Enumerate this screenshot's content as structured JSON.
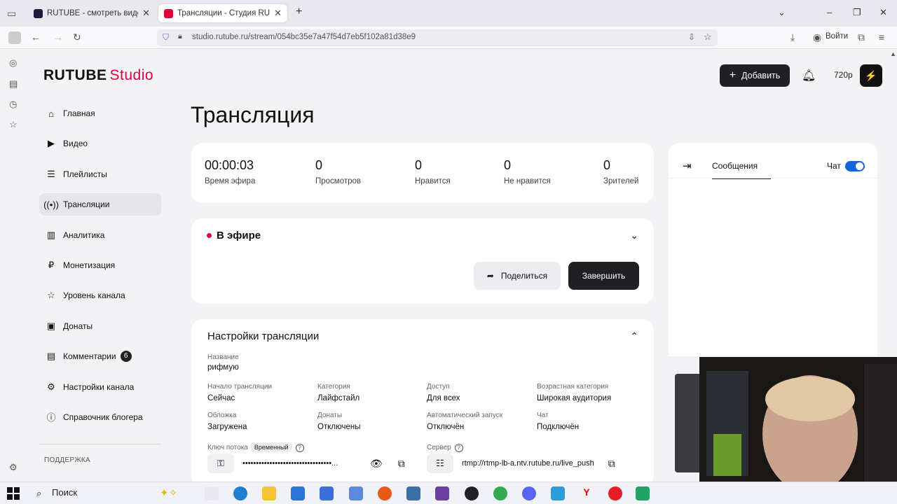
{
  "browser": {
    "tabs": [
      {
        "title": "RUTUBE - смотреть видео онл",
        "active": false
      },
      {
        "title": "Трансляции - Студия RUTUBE",
        "active": true
      }
    ],
    "url": "studio.rutube.ru/stream/054bc35e7a47f54d7eb5f102a81d38e9",
    "login_label": "Войти"
  },
  "app": {
    "logo_main": "RUTUBE",
    "logo_sub": "Studio",
    "add_label": "Добавить",
    "quality": "720p",
    "accent": "#e0003c"
  },
  "sidebar": {
    "items": [
      {
        "label": "Главная",
        "icon": "home-icon"
      },
      {
        "label": "Видео",
        "icon": "video-icon"
      },
      {
        "label": "Плейлисты",
        "icon": "playlist-icon"
      },
      {
        "label": "Трансляции",
        "icon": "broadcast-icon",
        "active": true
      },
      {
        "label": "Аналитика",
        "icon": "analytics-icon"
      },
      {
        "label": "Монетизация",
        "icon": "ruble-icon"
      },
      {
        "label": "Уровень канала",
        "icon": "star-icon"
      },
      {
        "label": "Донаты",
        "icon": "wallet-icon"
      },
      {
        "label": "Комментарии",
        "icon": "comment-icon",
        "badge": "6"
      },
      {
        "label": "Настройки канала",
        "icon": "gear-icon"
      },
      {
        "label": "Справочник блогера",
        "icon": "info-icon"
      }
    ],
    "support_label": "ПОДДЕРЖКА"
  },
  "page": {
    "title": "Трансляция"
  },
  "stats": [
    {
      "value": "00:00:03",
      "label": "Время эфира"
    },
    {
      "value": "0",
      "label": "Просмотров"
    },
    {
      "value": "0",
      "label": "Нравится"
    },
    {
      "value": "0",
      "label": "Не нравится"
    },
    {
      "value": "0",
      "label": "Зрителей"
    }
  ],
  "live": {
    "title": "В эфире",
    "share_label": "Поделиться",
    "finish_label": "Завершить"
  },
  "settings": {
    "title": "Настройки трансляции",
    "name_label": "Название",
    "name_value": "рифмую",
    "fields": [
      {
        "label": "Начало трансляции",
        "value": "Сейчас"
      },
      {
        "label": "Категория",
        "value": "Лайфстайл"
      },
      {
        "label": "Доступ",
        "value": "Для всех"
      },
      {
        "label": "Возрастная категория",
        "value": "Широкая аудитория"
      },
      {
        "label": "Обложка",
        "value": "Загружена"
      },
      {
        "label": "Донаты",
        "value": "Отключены"
      },
      {
        "label": "Автоматический запуск",
        "value": "Отключён"
      },
      {
        "label": "Чат",
        "value": "Подключён"
      }
    ],
    "key_label": "Ключ потока",
    "key_tag": "Временный",
    "key_value": "•••••••••••••••••••••••••••••••••...",
    "server_label": "Сервер",
    "server_value": "rtmp://rtmp-lb-a.ntv.rutube.ru/live_push"
  },
  "chat": {
    "tab_label": "Сообщения",
    "toggle_label": "Чат",
    "toggle_on": true
  },
  "taskbar": {
    "search_label": "Поиск"
  }
}
